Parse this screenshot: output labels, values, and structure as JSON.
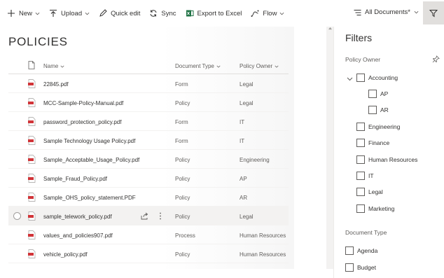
{
  "toolbar": {
    "new_label": "New",
    "upload_label": "Upload",
    "quick_edit_label": "Quick edit",
    "sync_label": "Sync",
    "export_label": "Export to Excel",
    "flow_label": "Flow",
    "overflow_label": "…"
  },
  "view": {
    "selector_label": "All Documents*"
  },
  "library": {
    "title": "POLICIES",
    "columns": {
      "name": "Name",
      "document_type": "Document Type",
      "policy_owner": "Policy Owner"
    },
    "rows": [
      {
        "name": "22845.pdf",
        "type": "Form",
        "owner": "Legal"
      },
      {
        "name": "MCC-Sample-Policy-Manual.pdf",
        "type": "Policy",
        "owner": "Legal"
      },
      {
        "name": "password_protection_policy.pdf",
        "type": "Form",
        "owner": "IT"
      },
      {
        "name": "Sample Technology Usage Policy.pdf",
        "type": "Form",
        "owner": "IT"
      },
      {
        "name": "Sample_Acceptable_Usage_Policy.pdf",
        "type": "Policy",
        "owner": "Engineering"
      },
      {
        "name": "Sample_Fraud_Policy.pdf",
        "type": "Policy",
        "owner": "AP"
      },
      {
        "name": "Sample_OHS_policy_statement.PDF",
        "type": "Policy",
        "owner": "AR"
      },
      {
        "name": "sample_telework_policy.pdf",
        "type": "Policy",
        "owner": "Legal"
      },
      {
        "name": "values_and_policies907.pdf",
        "type": "Process",
        "owner": "Human Resources"
      },
      {
        "name": "vehicle_policy.pdf",
        "type": "Policy",
        "owner": "Human Resources"
      }
    ]
  },
  "filters": {
    "title": "Filters",
    "policy_owner": {
      "label": "Policy Owner",
      "options": [
        "Accounting",
        "AP",
        "AR",
        "Engineering",
        "Finance",
        "Human Resources",
        "IT",
        "Legal",
        "Marketing"
      ]
    },
    "document_type": {
      "label": "Document Type",
      "options": [
        "Agenda",
        "Budget"
      ]
    }
  },
  "colors": {
    "pdf_red": "#d13438",
    "excel_green": "#217346",
    "accent": "#0078d4"
  }
}
